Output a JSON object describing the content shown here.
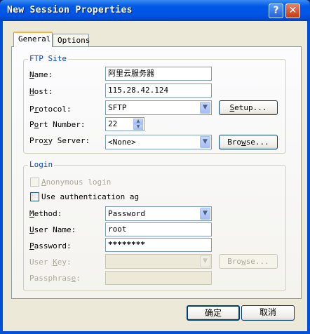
{
  "window": {
    "title": "New Session Properties",
    "help_glyph": "?",
    "close_glyph": "✕"
  },
  "tabs": [
    {
      "label": "General",
      "active": true
    },
    {
      "label": "Options",
      "active": false
    }
  ],
  "ftp_site": {
    "legend": "FTP Site",
    "name": {
      "label_u": "N",
      "label_rest": "ame:",
      "value": "阿里云服务器"
    },
    "host": {
      "label_u": "H",
      "label_rest": "ost:",
      "value": "115.28.42.124"
    },
    "protocol": {
      "label_pre": "P",
      "label_u": "r",
      "label_rest": "otocol:",
      "value": "SFTP"
    },
    "setup_button": {
      "label_u": "S",
      "label_rest": "etup..."
    },
    "port": {
      "label_pre": "P",
      "label_u": "o",
      "label_rest": "rt Number:",
      "value": "22"
    },
    "proxy": {
      "label_pre": "Pro",
      "label_u": "x",
      "label_rest": "y Server:",
      "value": "<None>"
    },
    "browse_button": {
      "label_pre": "Bro",
      "label_u": "w",
      "label_rest": "se..."
    }
  },
  "login": {
    "legend": "Login",
    "anonymous": {
      "label_u": "A",
      "label_rest": "nonymous login",
      "checked": false,
      "enabled": false
    },
    "use_auth": {
      "label": "Use authentication ag",
      "checked": false,
      "enabled": true
    },
    "method": {
      "label_u": "M",
      "label_rest": "ethod:",
      "value": "Password"
    },
    "user_name": {
      "label_u": "U",
      "label_rest": "ser Name:",
      "value": "root"
    },
    "password": {
      "label_u": "P",
      "label_rest": "assword:",
      "value": "********"
    },
    "user_key": {
      "label_pre": "User ",
      "label_u": "K",
      "label_rest": "ey:",
      "value": ""
    },
    "key_browse": {
      "label_pre": "Bro",
      "label_u": "w",
      "label_rest": "se..."
    },
    "passphrase": {
      "label_pre": "Passphras",
      "label_u": "e",
      "label_rest": ":",
      "value": ""
    }
  },
  "footer": {
    "ok_label": "确定",
    "cancel_label": "取消"
  },
  "colors": {
    "title_bar": "#0058e6",
    "dialog_bg": "#ece9d8",
    "legend_text": "#0046d5",
    "active_tab_accent": "#f8b33b"
  },
  "icons": {
    "dropdown": "chevron-down-icon",
    "spinner_up": "arrow-up-icon",
    "spinner_down": "arrow-down-icon"
  }
}
